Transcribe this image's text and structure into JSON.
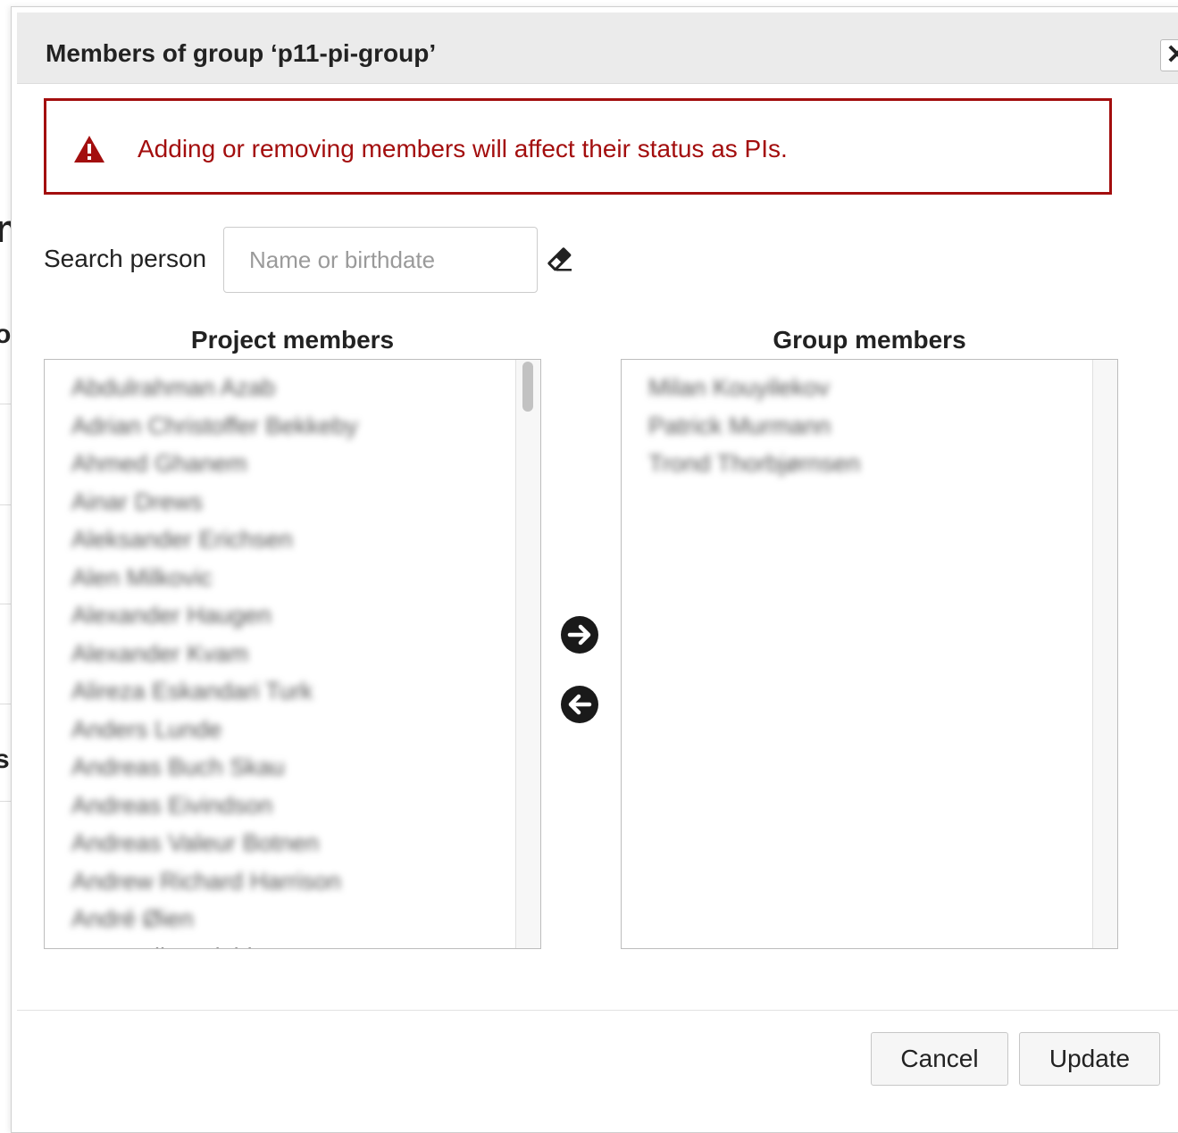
{
  "dialog": {
    "title": "Members of group ‘p11-pi-group’",
    "close_label": "✕"
  },
  "alert": {
    "message": "Adding or removing members will affect their status as PIs.",
    "color": "#a30e0e",
    "icon": "warning-triangle-icon"
  },
  "search": {
    "label": "Search person",
    "placeholder": "Name or birthdate",
    "clear_icon": "eraser-icon"
  },
  "project_members": {
    "title": "Project members",
    "items": [
      "Abdulrahman Azab",
      "Adrian Christoffer Bekkeby",
      "Ahmed Ghanem",
      "Ainar Drews",
      "Aleksander Erichsen",
      "Alen Milkovic",
      "Alexander Haugen",
      "Alexander Kvam",
      "Alireza Eskandari Turk",
      "Anders Lunde",
      "Andreas Buch Skau",
      "Andreas Eivindson",
      "Andreas Valeur Botnen",
      "Andrew Richard Harrison",
      "André Øien",
      "Ane Malin Solaid"
    ]
  },
  "group_members": {
    "title": "Group members",
    "items": [
      "Milan Kouyilekov",
      "Patrick Murmann",
      "Trond Thorbjørnsen"
    ]
  },
  "transfer": {
    "add_icon": "arrow-right-circle-icon",
    "remove_icon": "arrow-left-circle-icon"
  },
  "footer": {
    "cancel_label": "Cancel",
    "update_label": "Update"
  },
  "background": {
    "glyphs": [
      "n",
      "o",
      "s"
    ]
  }
}
